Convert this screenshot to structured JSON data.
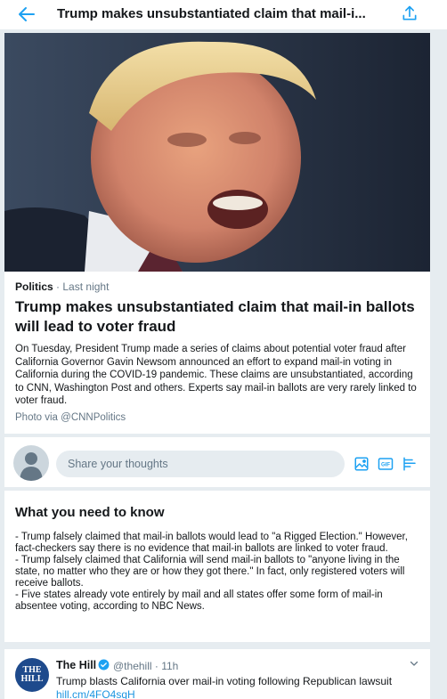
{
  "header": {
    "title": "Trump makes unsubstantiated claim that mail-i..."
  },
  "article": {
    "category": "Politics",
    "separator": "·",
    "time": "Last night",
    "title": "Trump makes unsubstantiated claim that mail-in ballots will lead to voter fraud",
    "body": "On Tuesday, President Trump made a series of claims about potential voter fraud after California Governor Gavin Newsom announced an effort to expand mail-in voting in California during the COVID-19 pandemic. These claims are unsubstantiated, according to CNN, Washington Post and others. Experts say mail-in ballots are very rarely linked to voter fraud.",
    "photo_credit": "Photo via @CNNPolitics"
  },
  "composer": {
    "placeholder": "Share your thoughts"
  },
  "know": {
    "title": "What you need to know",
    "items": [
      "- Trump falsely claimed that mail-in ballots would lead to \"a Rigged Election.\" However, fact-checkers say there is no evidence that mail-in ballots are linked to voter fraud.",
      "- Trump falsely claimed that California will send mail-in ballots to \"anyone living in the state, no matter who they are or how they got there.\" In fact, only registered voters will receive ballots.",
      "- Five states already vote entirely by mail and all states offer some form of mail-in absentee voting, according to NBC News."
    ]
  },
  "tweet": {
    "logo_line1": "THE",
    "logo_line2": "HILL",
    "name": "The Hill",
    "handle_time": "@thehill · 11h",
    "text": "Trump blasts California over mail-in voting following Republican lawsuit",
    "link": "hill.cm/4FO4sqH"
  },
  "colors": {
    "accent": "#1da1f2",
    "background": "#e6ecf0",
    "secondary_text": "#657786",
    "hill_logo": "#1e4a8c"
  },
  "icons": [
    "back-arrow-icon",
    "share-icon",
    "image-icon",
    "gif-icon",
    "poll-icon",
    "verified-icon",
    "chevron-down-icon",
    "avatar-placeholder-icon"
  ]
}
